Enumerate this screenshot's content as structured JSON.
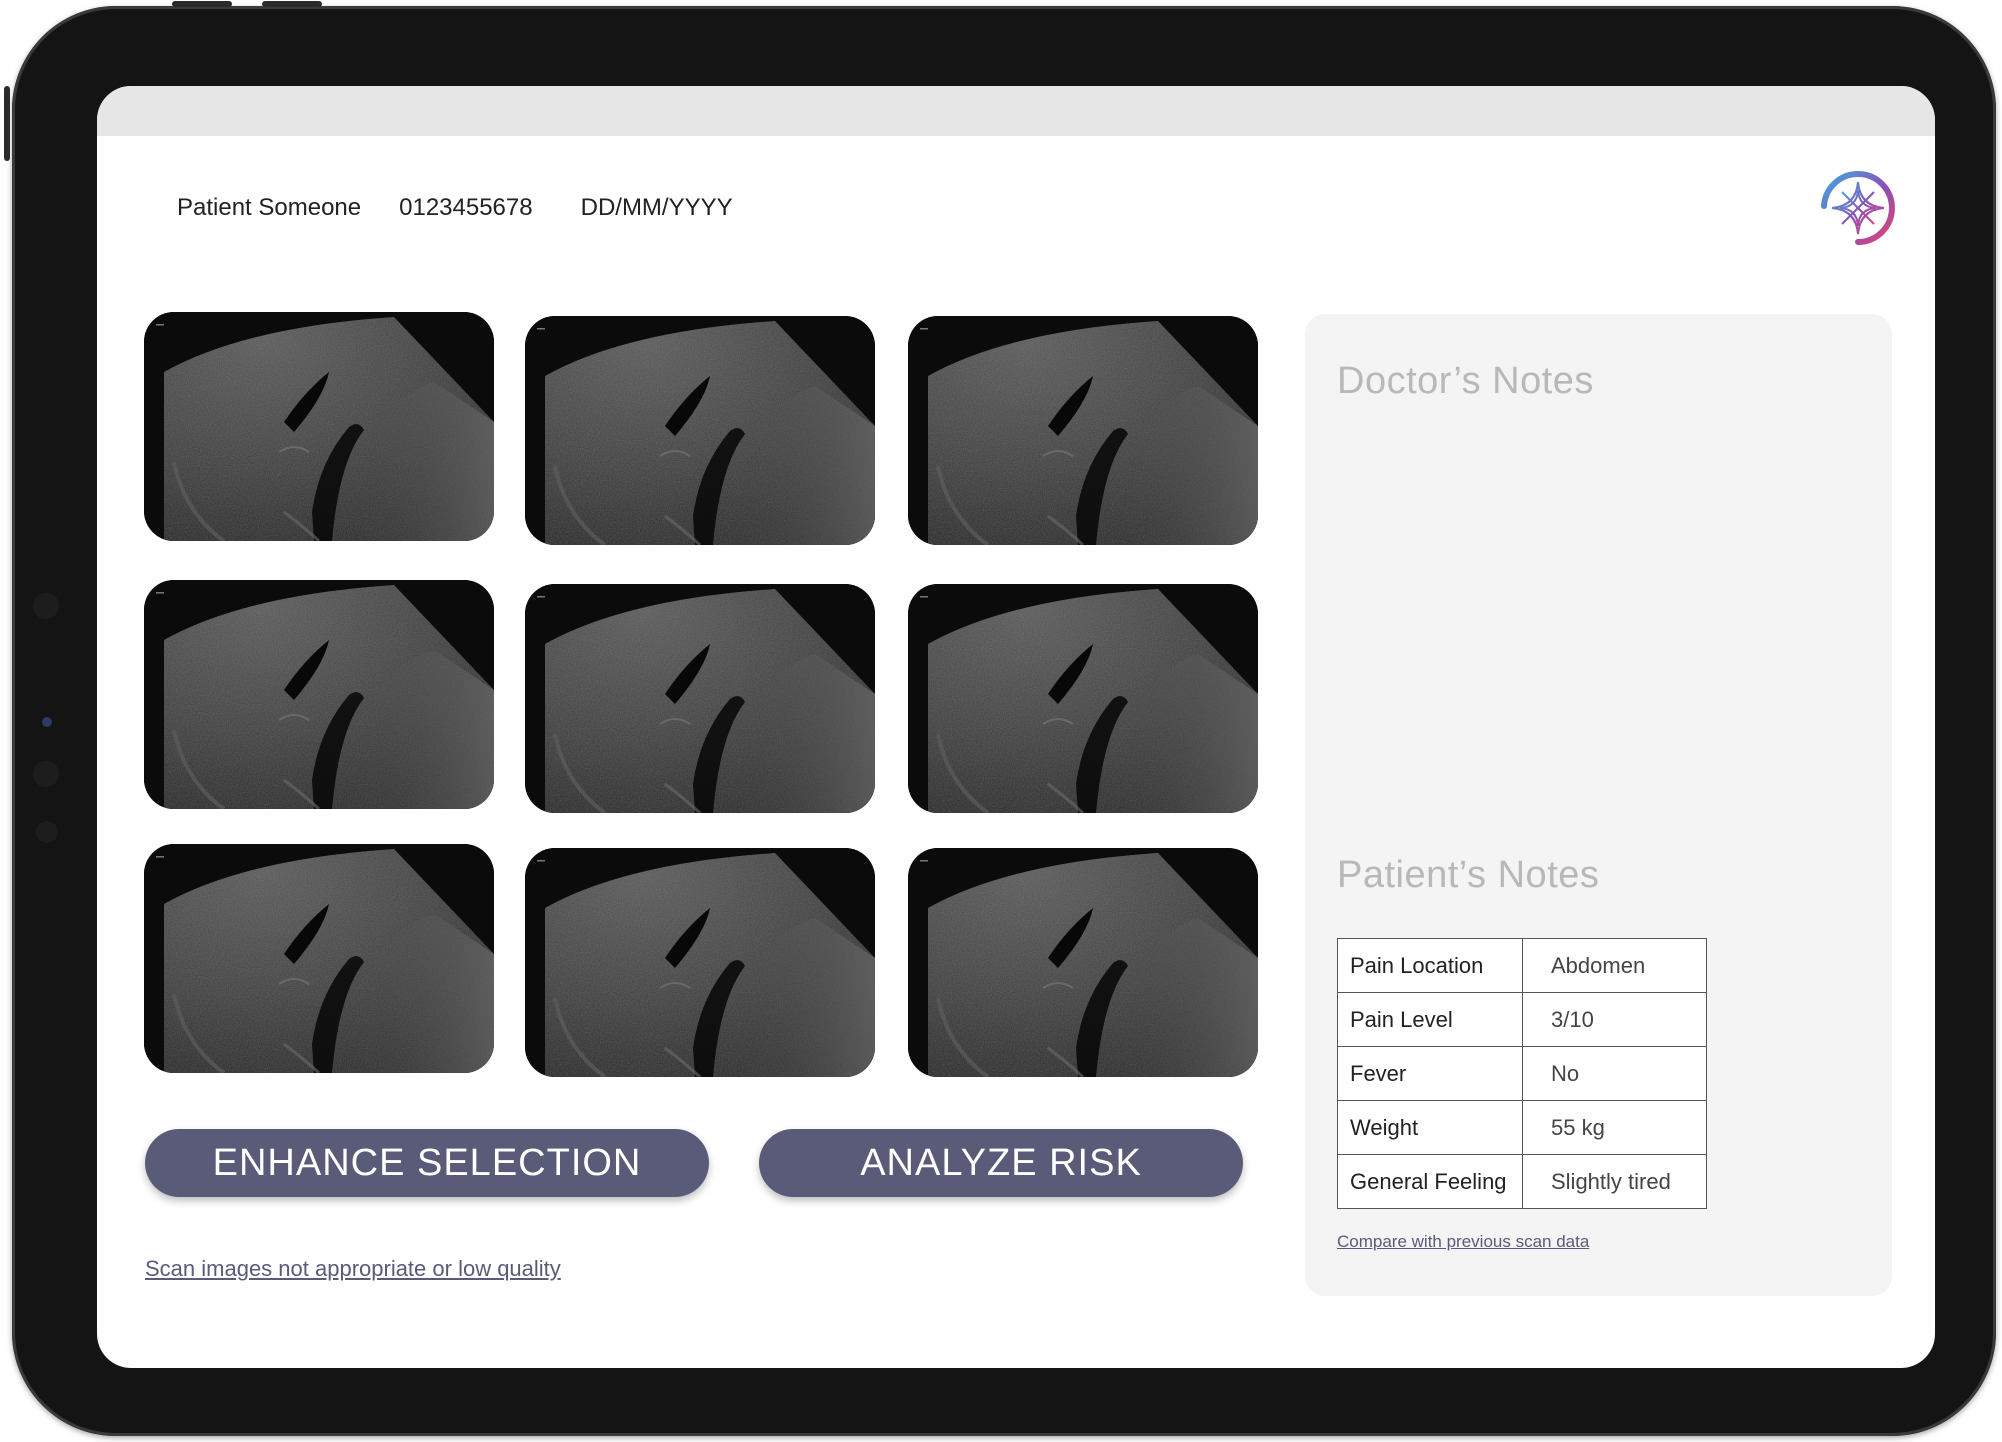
{
  "header": {
    "patient_name": "Patient Someone",
    "patient_id": "0123455678",
    "date": "DD/MM/YYYY",
    "logo_icon": "app-logo-icon"
  },
  "scans": {
    "count": 9,
    "icon": "ultrasound-scan-image"
  },
  "actions": {
    "enhance_label": "ENHANCE SELECTION",
    "analyze_label": "ANALYZE RISK",
    "bad_scan_link": "Scan images not appropriate or low quality"
  },
  "notes": {
    "doctor_title": "Doctor’s Notes",
    "patient_title": "Patient’s Notes",
    "rows": [
      {
        "key": "Pain Location",
        "value": "Abdomen"
      },
      {
        "key": "Pain Level",
        "value": "3/10"
      },
      {
        "key": "Fever",
        "value": "No"
      },
      {
        "key": "Weight",
        "value": "55 kg"
      },
      {
        "key": "General Feeling",
        "value": "Slightly tired"
      }
    ],
    "compare_link": "Compare with previous scan data"
  },
  "colors": {
    "accent": "#5a5b79",
    "panel": "#f4f4f4",
    "muted_title": "#b8b8b8",
    "bezel": "#141414"
  }
}
